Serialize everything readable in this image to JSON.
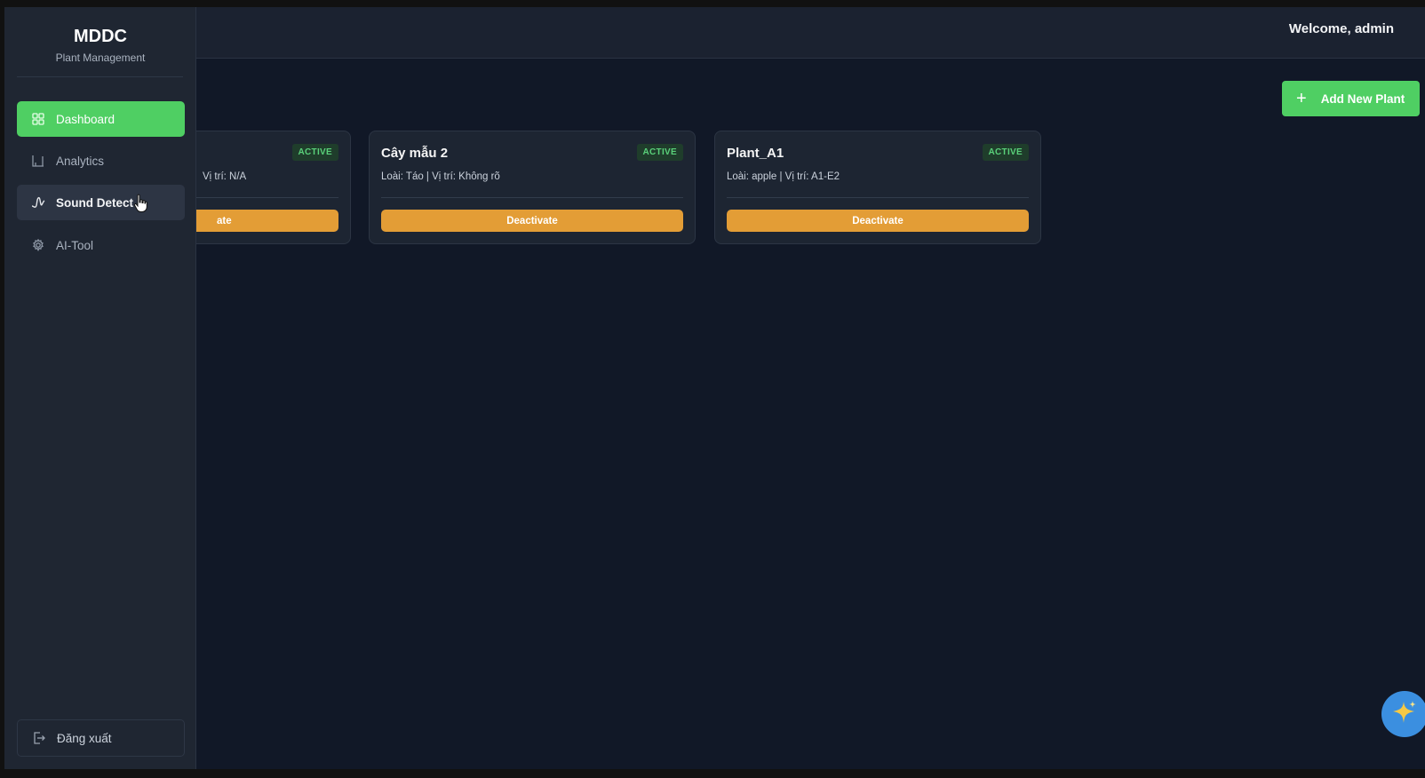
{
  "topbar": {
    "welcome": "Welcome, admin"
  },
  "sidebar": {
    "brand": "MDDC",
    "subtitle": "Plant Management",
    "items": [
      {
        "label": "Dashboard",
        "icon": "grid-icon",
        "state": "active"
      },
      {
        "label": "Analytics",
        "icon": "chart-icon",
        "state": "normal"
      },
      {
        "label": "Sound Detect",
        "icon": "waveform-icon",
        "state": "hover"
      },
      {
        "label": "AI-Tool",
        "icon": "gear-icon",
        "state": "normal"
      }
    ],
    "logout": "Đăng xuất"
  },
  "main": {
    "add_button": "Add New Plant",
    "cards": [
      {
        "name": "",
        "meta": "Vị trí: N/A",
        "status": "ACTIVE",
        "action": "ate"
      },
      {
        "name": "Cây mẫu 2",
        "meta": "Loài: Táo | Vị trí: Không rõ",
        "status": "ACTIVE",
        "action": "Deactivate"
      },
      {
        "name": "Plant_A1",
        "meta": "Loài: apple | Vị trí: A1-E2",
        "status": "ACTIVE",
        "action": "Deactivate"
      }
    ]
  },
  "colors": {
    "accent_green": "#4fcf63",
    "deactivate_orange": "#e39d36",
    "background": "#111827",
    "sidebar": "#1f2632",
    "fab_blue": "#3b8fe0"
  },
  "fab": {
    "icon": "sparkle-icon"
  }
}
